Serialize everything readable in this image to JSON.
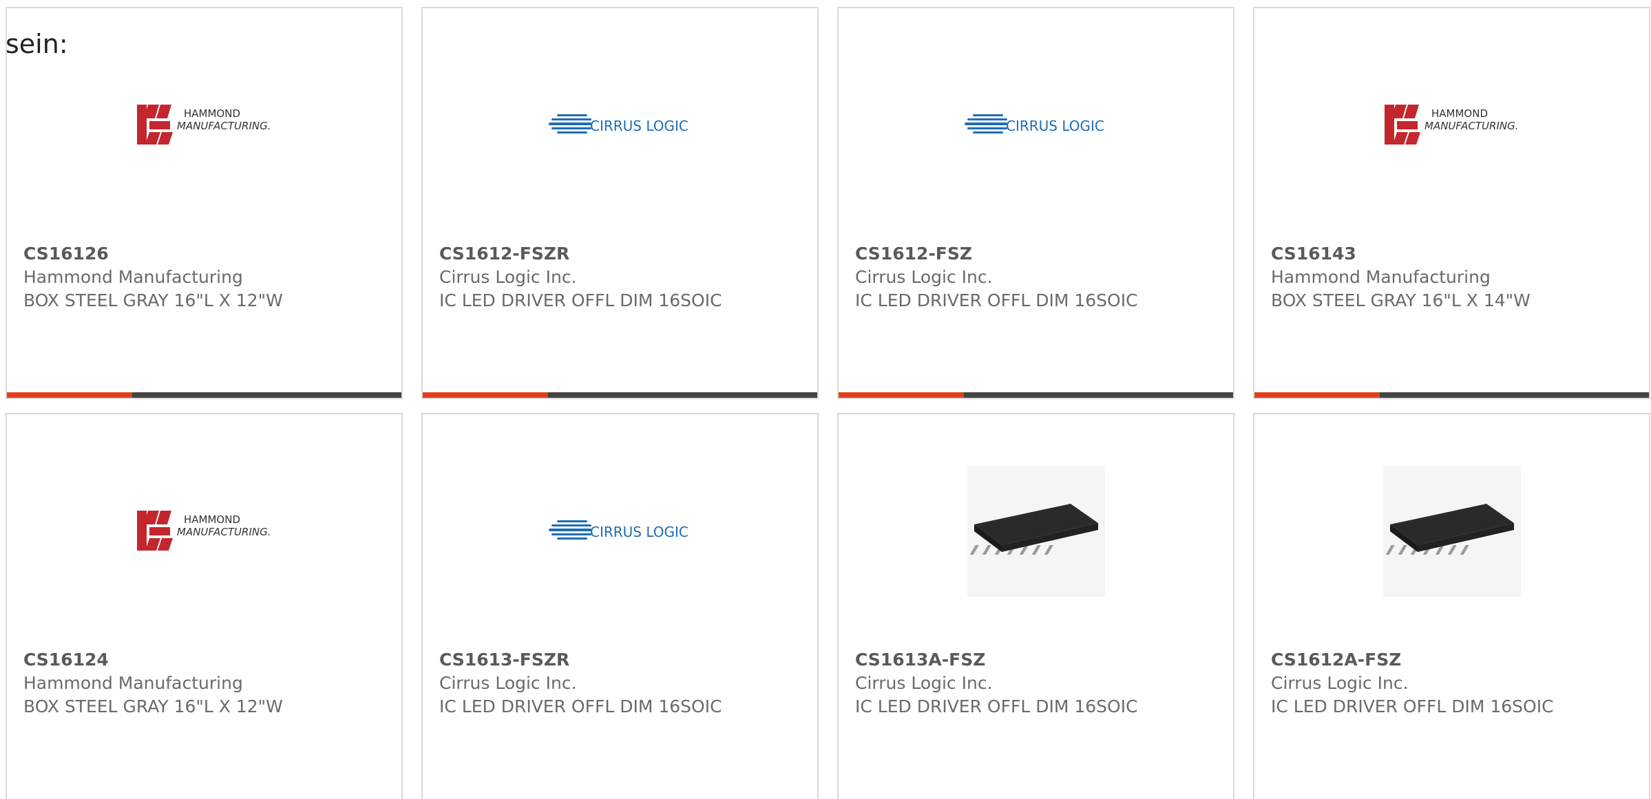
{
  "intro_text": "sein:",
  "brand_colors": {
    "accent": "#e0401d",
    "bar": "#444444",
    "hammond_red": "#c4262e",
    "cirrus_blue": "#1f6db5"
  },
  "products": [
    {
      "part_number": "CS16126",
      "manufacturer": "Hammond Manufacturing",
      "description": "BOX STEEL GRAY 16\"L X 12\"W",
      "image": "hammond-logo",
      "logo_line1": "HAMMOND",
      "logo_line2": "MANUFACTURING."
    },
    {
      "part_number": "CS1612-FSZR",
      "manufacturer": "Cirrus Logic Inc.",
      "description": "IC LED DRIVER OFFL DIM 16SOIC",
      "image": "cirrus-logic-logo",
      "logo_text": "CIRRUS LOGIC"
    },
    {
      "part_number": "CS1612-FSZ",
      "manufacturer": "Cirrus Logic Inc.",
      "description": "IC LED DRIVER OFFL DIM 16SOIC",
      "image": "cirrus-logic-logo",
      "logo_text": "CIRRUS LOGIC"
    },
    {
      "part_number": "CS16143",
      "manufacturer": "Hammond Manufacturing",
      "description": "BOX STEEL GRAY 16\"L X 14\"W",
      "image": "hammond-logo",
      "logo_line1": "HAMMOND",
      "logo_line2": "MANUFACTURING."
    },
    {
      "part_number": "CS16124",
      "manufacturer": "Hammond Manufacturing",
      "description": "BOX STEEL GRAY 16\"L X 12\"W",
      "image": "hammond-logo",
      "logo_line1": "HAMMOND",
      "logo_line2": "MANUFACTURING."
    },
    {
      "part_number": "CS1613-FSZR",
      "manufacturer": "Cirrus Logic Inc.",
      "description": "IC LED DRIVER OFFL DIM 16SOIC",
      "image": "cirrus-logic-logo",
      "logo_text": "CIRRUS LOGIC"
    },
    {
      "part_number": "CS1613A-FSZ",
      "manufacturer": "Cirrus Logic Inc.",
      "description": "IC LED DRIVER OFFL DIM 16SOIC",
      "image": "soic-chip-photo"
    },
    {
      "part_number": "CS1612A-FSZ",
      "manufacturer": "Cirrus Logic Inc.",
      "description": "IC LED DRIVER OFFL DIM 16SOIC",
      "image": "soic-chip-photo"
    }
  ]
}
